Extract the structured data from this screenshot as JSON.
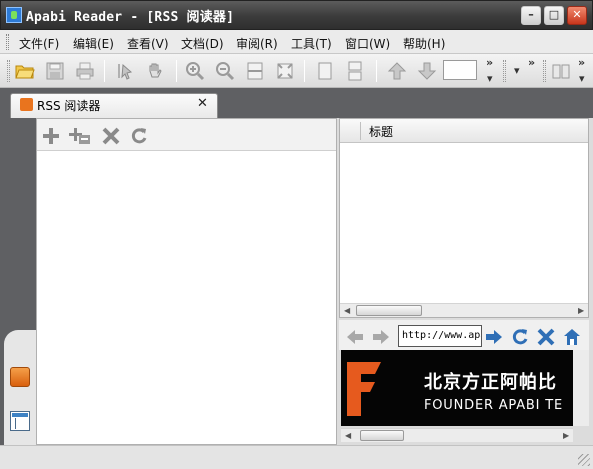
{
  "window": {
    "title": "Apabi Reader - [RSS 阅读器]",
    "min_glyph": "–",
    "max_glyph": "□",
    "close_glyph": "✕"
  },
  "menu": {
    "items": [
      "文件(F)",
      "编辑(E)",
      "查看(V)",
      "文档(D)",
      "审阅(R)",
      "工具(T)",
      "窗口(W)",
      "帮助(H)"
    ]
  },
  "toolbar": {
    "buttons": [
      "open-icon",
      "save-icon",
      "print-icon",
      "select-tool-icon",
      "hand-tool-icon",
      "zoom-in-icon",
      "zoom-out-icon",
      "fit-width-icon",
      "fit-page-icon",
      "single-page-icon",
      "continuous-page-icon",
      "prev-page-icon",
      "next-page-icon",
      "bookshelf-icon"
    ],
    "page_value": "",
    "overflow_glyph": "»",
    "dropdown_glyph": "▾"
  },
  "tab": {
    "label": "RSS 阅读器",
    "close_glyph": "✕"
  },
  "feed_toolbar": {
    "buttons": [
      "add-feed-icon",
      "add-folder-icon",
      "delete-icon",
      "refresh-icon"
    ]
  },
  "article_list": {
    "columns": [
      "标题"
    ],
    "rows": []
  },
  "browser": {
    "url": "http://www.apabi.com",
    "banner_cn": "北京方正阿帕比",
    "banner_en": "FOUNDER APABI TE"
  },
  "colors": {
    "titlebar": "#3b3b3b",
    "tabstrip": "#5f6063",
    "accent_orange": "#e65a1e",
    "nav_blue": "#2f6fb6"
  }
}
